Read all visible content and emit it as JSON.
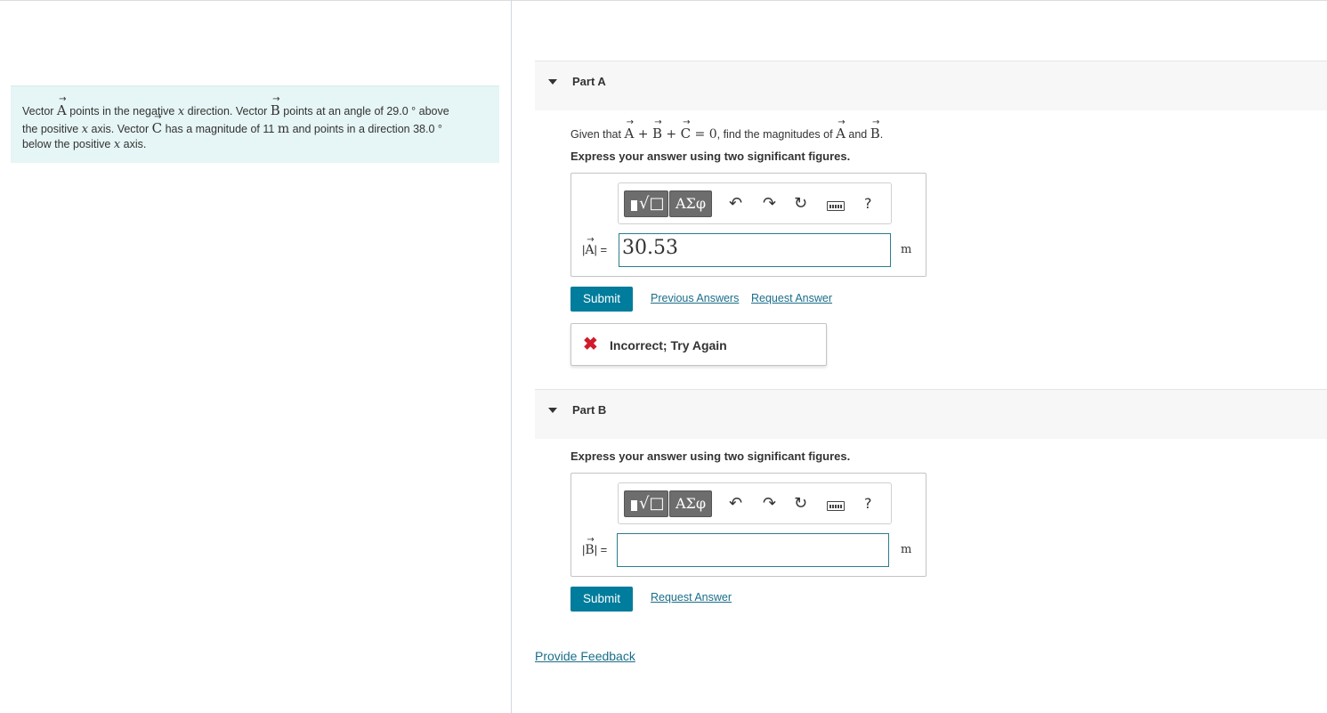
{
  "problem": {
    "t1": "Vector ",
    "vecA": "A",
    "t2": " points in the negative ",
    "x1": "x",
    "t3": " direction. Vector ",
    "vecB": "B",
    "t4": " points at an angle of 29.0 ° above",
    "t5": "the positive ",
    "x2": "x",
    "t6": " axis. Vector ",
    "vecC": "C",
    "t7": " has a magnitude of 11 ",
    "unit": "m",
    "t8": " and points in a direction 38.0 °",
    "t9": "below the positive ",
    "x3": "x",
    "t10": " axis."
  },
  "arrow_glyph": "→",
  "partA": {
    "title": "Part A",
    "q_prefix": "Given that ",
    "q_eq_1": "A",
    "q_plus": " + ",
    "q_eq_2": "B",
    "q_eq_3": "C",
    "q_zero": " = 0",
    "q_mid": ", find the magnitudes of ",
    "q_v1": "A",
    "q_and": " and ",
    "q_v2": "B",
    "q_end": ".",
    "instruction": "Express your answer using two significant figures.",
    "var_open": "|",
    "var_letter": "A",
    "var_close": "| =",
    "answer_value": "30.53",
    "unit": "m",
    "submit_label": "Submit",
    "previous_answers_label": "Previous Answers",
    "request_answer_label": "Request Answer",
    "feedback_text": "Incorrect; Try Again",
    "feedback_icon": "✖"
  },
  "partB": {
    "title": "Part B",
    "instruction": "Express your answer using two significant figures.",
    "var_open": "|",
    "var_letter": "B",
    "var_close": "| =",
    "answer_value": "",
    "unit": "m",
    "submit_label": "Submit",
    "request_answer_label": "Request Answer"
  },
  "toolbar": {
    "template_glyph": "√□",
    "greek_label": "ΑΣφ",
    "undo_glyph": "↶",
    "redo_glyph": "↷",
    "reset_glyph": "↻",
    "help_label": "?"
  },
  "provide_feedback_label": "Provide Feedback",
  "colors": {
    "accent": "#007c9c",
    "link": "#1a6d8a",
    "error": "#d11b2a",
    "problem_bg": "#e6f5f5"
  }
}
